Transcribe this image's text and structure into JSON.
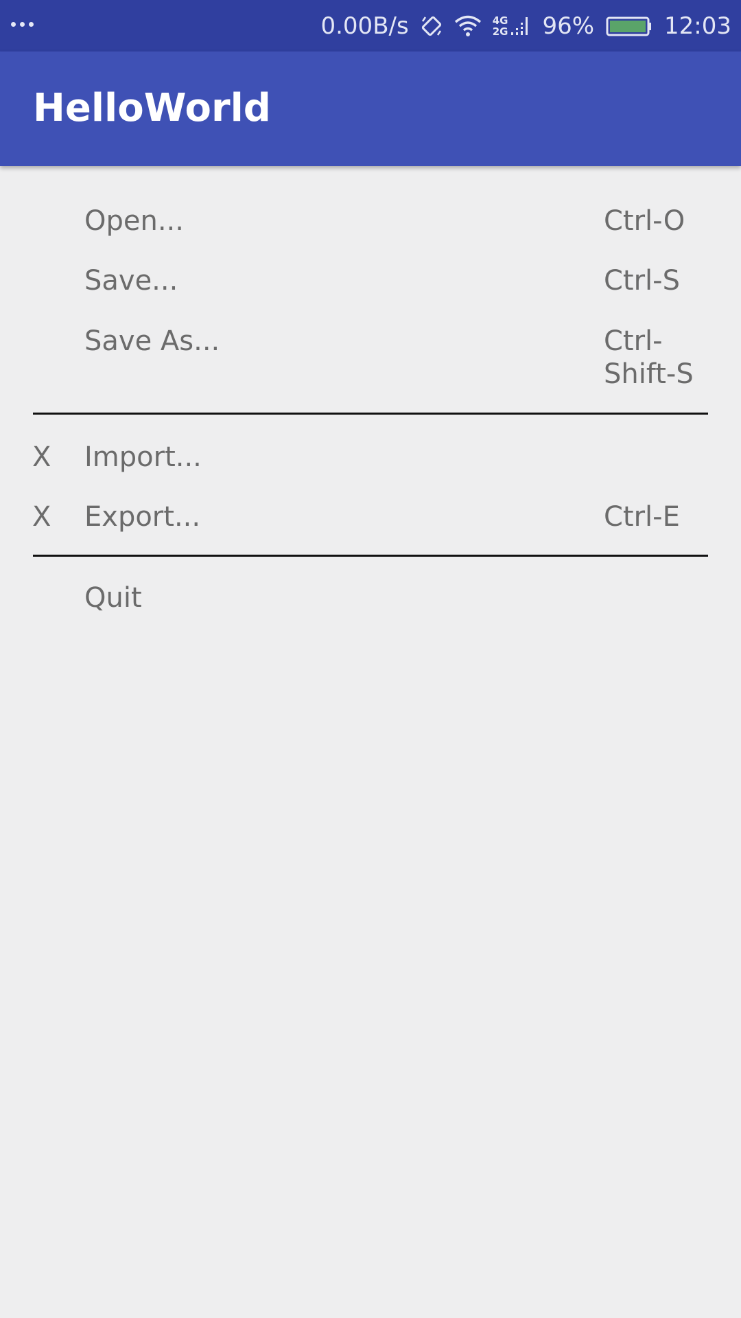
{
  "status_bar": {
    "speed": "0.00B/s",
    "network_top": "4G",
    "network_bottom": "2G",
    "battery": "96%",
    "time": "12:03",
    "icons": [
      "more-dots-icon",
      "screen-rotation-icon",
      "wifi-icon",
      "signal-icon",
      "battery-icon"
    ],
    "battery_color": "#5aa469"
  },
  "app_bar": {
    "title": "HelloWorld",
    "color": "#3f51b5"
  },
  "menu": {
    "items": [
      {
        "check": "",
        "label": "Open...",
        "shortcut": "Ctrl-O"
      },
      {
        "check": "",
        "label": "Save...",
        "shortcut": "Ctrl-S"
      },
      {
        "check": "",
        "label": "Save As...",
        "shortcut": "Ctrl-\nShift-S"
      },
      {
        "check": "X",
        "label": "Import...",
        "shortcut": ""
      },
      {
        "check": "X",
        "label": "Export...",
        "shortcut": "Ctrl-E"
      },
      {
        "check": "",
        "label": "Quit",
        "shortcut": ""
      }
    ]
  }
}
